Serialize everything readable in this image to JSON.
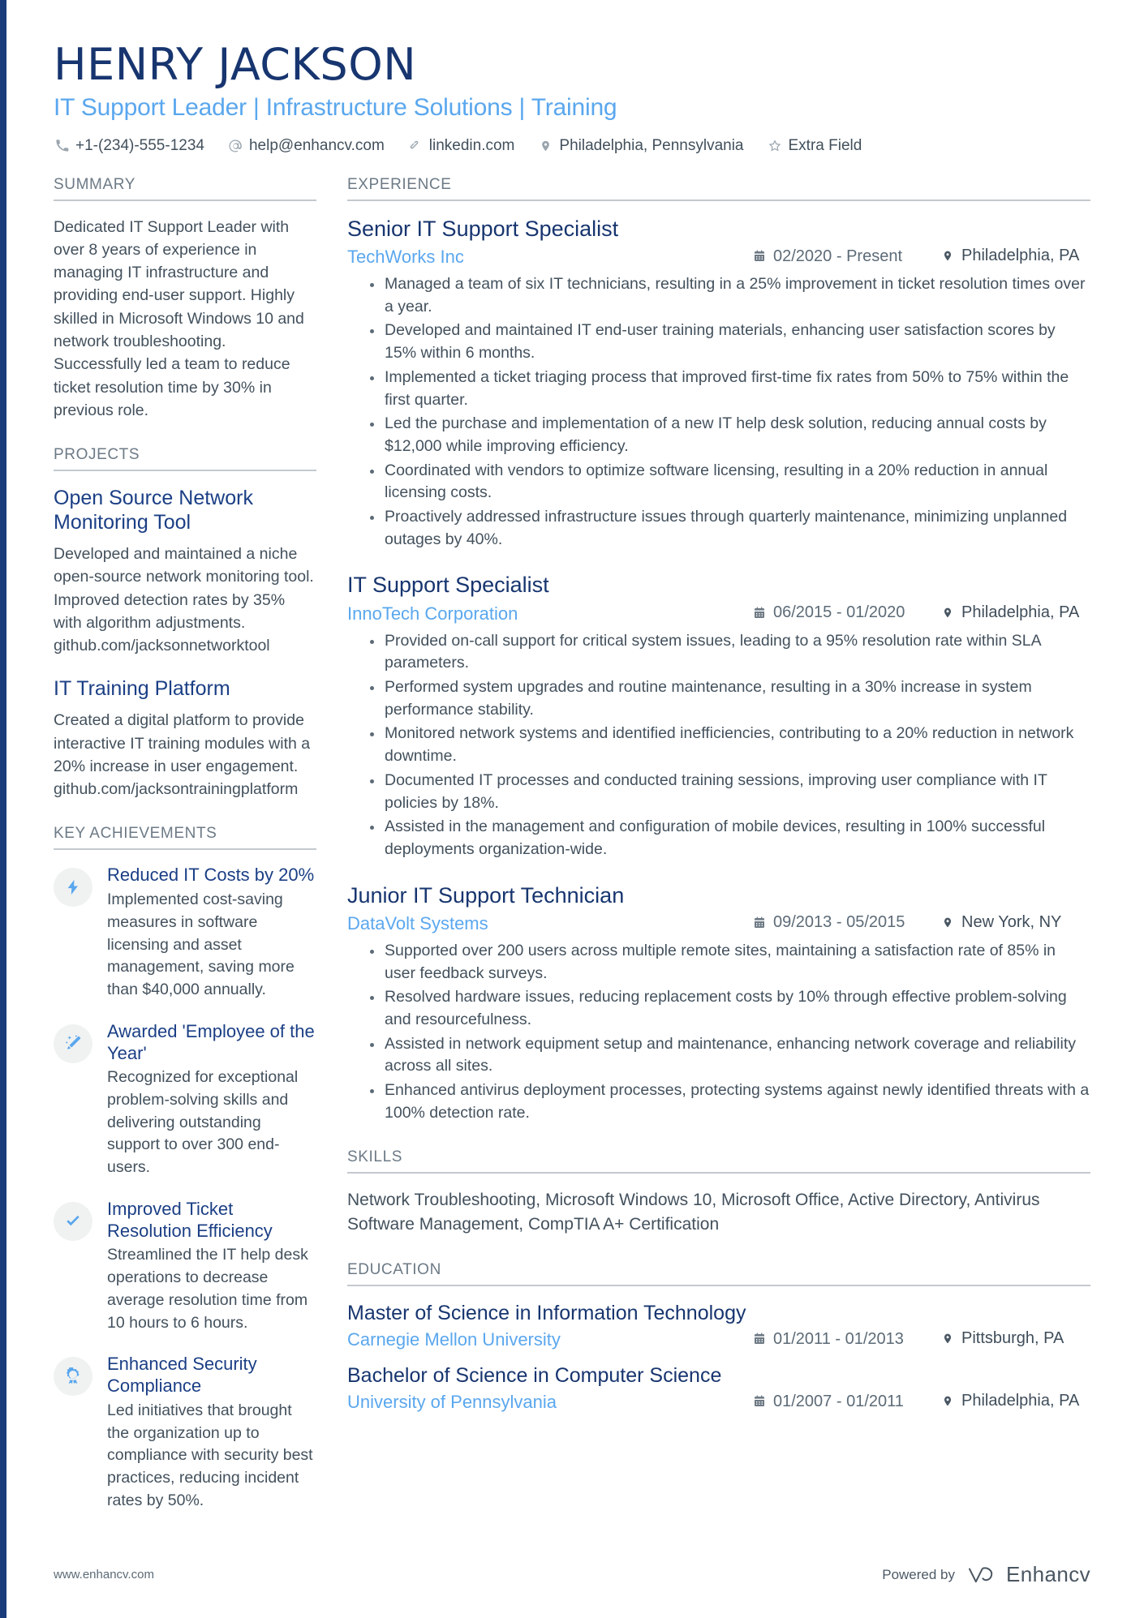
{
  "header": {
    "name": "HENRY JACKSON",
    "headline": "IT Support Leader | Infrastructure Solutions | Training",
    "contacts": [
      {
        "icon": "phone-icon",
        "text": "+1-(234)-555-1234"
      },
      {
        "icon": "email-icon",
        "text": "help@enhancv.com"
      },
      {
        "icon": "link-icon",
        "text": "linkedin.com"
      },
      {
        "icon": "location-icon",
        "text": "Philadelphia, Pennsylvania"
      },
      {
        "icon": "star-icon",
        "text": "Extra Field"
      }
    ]
  },
  "sections": {
    "summary_title": "SUMMARY",
    "projects_title": "PROJECTS",
    "achievements_title": "KEY ACHIEVEMENTS",
    "experience_title": "EXPERIENCE",
    "skills_title": "SKILLS",
    "education_title": "EDUCATION"
  },
  "summary": {
    "text": "Dedicated IT Support Leader with over 8 years of experience in managing IT infrastructure and providing end-user support. Highly skilled in Microsoft Windows 10 and network troubleshooting. Successfully led a team to reduce ticket resolution time by 30% in previous role."
  },
  "projects": [
    {
      "title": "Open Source Network Monitoring Tool",
      "description": "Developed and maintained a niche open-source network monitoring tool. Improved detection rates by 35% with algorithm adjustments.",
      "link": "github.com/jacksonnetworktool"
    },
    {
      "title": "IT Training Platform",
      "description": "Created a digital platform to provide interactive IT training modules with a 20% increase in user engagement.",
      "link": "github.com/jacksontrainingplatform"
    }
  ],
  "achievements": [
    {
      "icon": "lightning-bolt-icon",
      "title": "Reduced IT Costs by 20%",
      "description": "Implemented cost-saving measures in software licensing and asset management, saving more than $40,000 annually."
    },
    {
      "icon": "magic-wand-icon",
      "title": "Awarded 'Employee of the Year'",
      "description": "Recognized for exceptional problem-solving skills and delivering outstanding support to over 300 end-users."
    },
    {
      "icon": "checkmark-icon",
      "title": "Improved Ticket Resolution Efficiency",
      "description": "Streamlined the IT help desk operations to decrease average resolution time from 10 hours to 6 hours."
    },
    {
      "icon": "award-ribbon-icon",
      "title": "Enhanced Security Compliance",
      "description": "Led initiatives that brought the organization up to compliance with security best practices, reducing incident rates by 50%."
    }
  ],
  "experience": [
    {
      "title": "Senior IT Support Specialist",
      "company": "TechWorks Inc",
      "dates": "02/2020 - Present",
      "location": "Philadelphia, PA",
      "bullets": [
        "Managed a team of six IT technicians, resulting in a 25% improvement in ticket resolution times over a year.",
        "Developed and maintained IT end-user training materials, enhancing user satisfaction scores by 15% within 6 months.",
        "Implemented a ticket triaging process that improved first-time fix rates from 50% to 75% within the first quarter.",
        "Led the purchase and implementation of a new IT help desk solution, reducing annual costs by $12,000 while improving efficiency.",
        "Coordinated with vendors to optimize software licensing, resulting in a 20% reduction in annual licensing costs.",
        "Proactively addressed infrastructure issues through quarterly maintenance, minimizing unplanned outages by 40%."
      ]
    },
    {
      "title": "IT Support Specialist",
      "company": "InnoTech Corporation",
      "dates": "06/2015 - 01/2020",
      "location": "Philadelphia, PA",
      "bullets": [
        "Provided on-call support for critical system issues, leading to a 95% resolution rate within SLA parameters.",
        "Performed system upgrades and routine maintenance, resulting in a 30% increase in system performance stability.",
        "Monitored network systems and identified inefficiencies, contributing to a 20% reduction in network downtime.",
        "Documented IT processes and conducted training sessions, improving user compliance with IT policies by 18%.",
        "Assisted in the management and configuration of mobile devices, resulting in 100% successful deployments organization-wide."
      ]
    },
    {
      "title": "Junior IT Support Technician",
      "company": "DataVolt Systems",
      "dates": "09/2013 - 05/2015",
      "location": "New York, NY",
      "bullets": [
        "Supported over 200 users across multiple remote sites, maintaining a satisfaction rate of 85% in user feedback surveys.",
        "Resolved hardware issues, reducing replacement costs by 10% through effective problem-solving and resourcefulness.",
        "Assisted in network equipment setup and maintenance, enhancing network coverage and reliability across all sites.",
        "Enhanced antivirus deployment processes, protecting systems against newly identified threats with a 100% detection rate."
      ]
    }
  ],
  "skills": {
    "text": "Network Troubleshooting, Microsoft Windows 10, Microsoft Office, Active Directory, Antivirus Software Management, CompTIA A+ Certification"
  },
  "education": [
    {
      "degree": "Master of Science in Information Technology",
      "school": "Carnegie Mellon University",
      "dates": "01/2011 - 01/2013",
      "location": "Pittsburgh, PA"
    },
    {
      "degree": "Bachelor of Science in Computer Science",
      "school": "University of Pennsylvania",
      "dates": "01/2007 - 01/2011",
      "location": "Philadelphia, PA"
    }
  ],
  "footer": {
    "website": "www.enhancv.com",
    "powered_by": "Powered by",
    "brand": "Enhancv"
  },
  "colors": {
    "navy": "#17356f",
    "blue_link": "#5aa7ee",
    "accent_bar": "#1a3c7a",
    "body_text": "#43515d",
    "rule": "#c3c9ce"
  }
}
